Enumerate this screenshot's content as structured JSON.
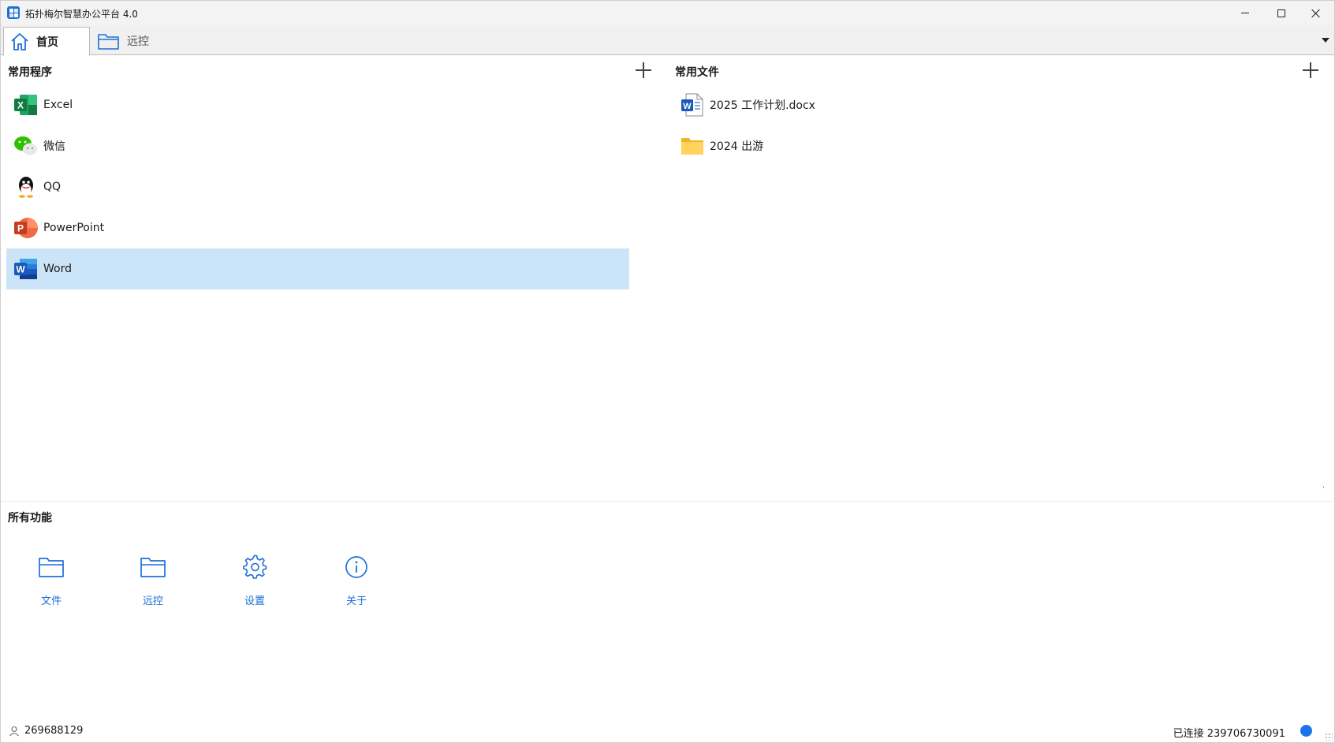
{
  "window": {
    "title": "拓扑梅尔智慧办公平台 4.0"
  },
  "tabs": [
    {
      "label": "首页",
      "icon": "home-icon",
      "active": true
    },
    {
      "label": "远控",
      "icon": "folder-icon",
      "active": false
    }
  ],
  "programs": {
    "title": "常用程序",
    "items": [
      {
        "label": "Excel",
        "icon": "excel-icon"
      },
      {
        "label": "微信",
        "icon": "wechat-icon"
      },
      {
        "label": "QQ",
        "icon": "qq-icon"
      },
      {
        "label": "PowerPoint",
        "icon": "powerpoint-icon"
      },
      {
        "label": "Word",
        "icon": "word-icon",
        "selected": true
      }
    ]
  },
  "files": {
    "title": "常用文件",
    "items": [
      {
        "label": "2025 工作计划.docx",
        "icon": "word-doc-icon"
      },
      {
        "label": "2024 出游",
        "icon": "folder-icon"
      }
    ]
  },
  "features": {
    "title": "所有功能",
    "items": [
      {
        "label": "文件",
        "icon": "folder-icon"
      },
      {
        "label": "远控",
        "icon": "folder-icon"
      },
      {
        "label": "设置",
        "icon": "gear-icon"
      },
      {
        "label": "关于",
        "icon": "info-icon"
      }
    ]
  },
  "status": {
    "user_id": "269688129",
    "connection": "已连接 239706730091",
    "connection_color": "#1a73e8"
  },
  "colors": {
    "accent": "#1e6fd9",
    "selection": "#cce4f7"
  }
}
